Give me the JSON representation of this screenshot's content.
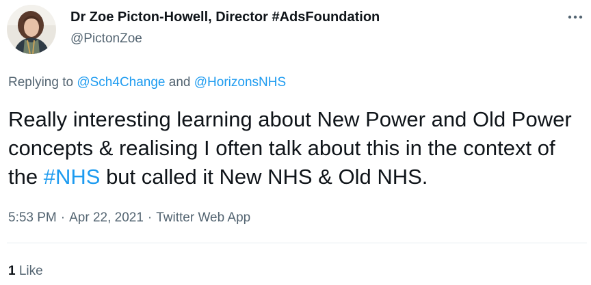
{
  "author": {
    "display_name": "Dr Zoe Picton-Howell, Director #AdsFoundation",
    "handle": "@PictonZoe"
  },
  "reply": {
    "prefix": "Replying to",
    "mention_1": "@Sch4Change",
    "conjunction": "and",
    "mention_2": "@HorizonsNHS"
  },
  "tweet": {
    "text_before": "Really interesting learning about New Power and Old Power concepts & realising I often talk about this in the context of the",
    "hashtag": "#NHS",
    "text_after": "but called it New NHS & Old NHS."
  },
  "meta": {
    "time": "5:53 PM",
    "separator": "·",
    "date": "Apr 22, 2021",
    "source": "Twitter Web App"
  },
  "stats": {
    "like_count": "1",
    "like_label": "Like"
  },
  "icons": {
    "avatar": "profile-photo",
    "more": "more-horizontal-icon"
  },
  "colors": {
    "link": "#1d9bf0",
    "secondary_text": "#536471",
    "primary_text": "#0f1419",
    "divider": "#e6ecf0"
  }
}
